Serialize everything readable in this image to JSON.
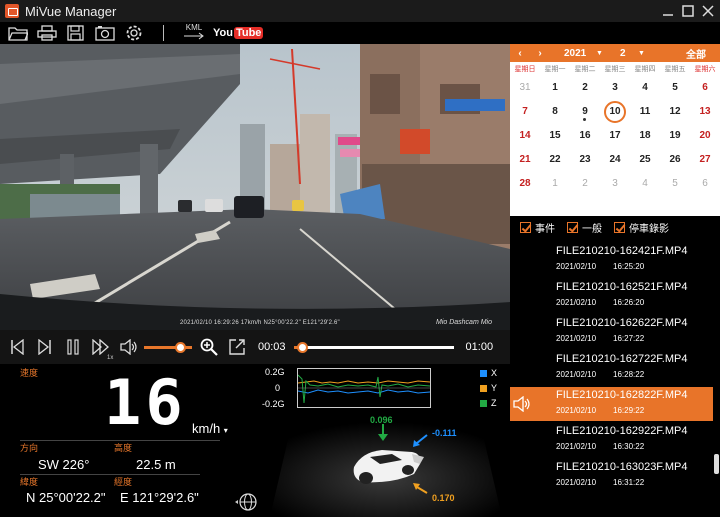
{
  "window": {
    "title": "MiVue Manager"
  },
  "toolbar": {
    "kml_label": "KML",
    "youtube_you": "You",
    "youtube_tube": "Tube"
  },
  "video": {
    "overlay_text": "2021/02/10  16:29:26  17km/h  N25°00'22.2\"  E121°29'2.6\"",
    "brand": "Mio Dashcam  Mio"
  },
  "controls": {
    "speed_label": "1x",
    "current_time": "00:03",
    "total_time": "01:00",
    "progress": 0.05,
    "volume": 0.75
  },
  "info": {
    "speed_label": "速度",
    "speed_value": "16",
    "speed_unit": "km/h",
    "heading_label": "方向",
    "heading_value": "SW 226°",
    "altitude_label": "高度",
    "altitude_value": "22.5  m",
    "latitude_label": "緯度",
    "latitude_value": "N 25°00'22.2\"",
    "longitude_label": "經度",
    "longitude_value": "E 121°29'2.6\""
  },
  "gsensor": {
    "y_labels": [
      "0.2G",
      "0",
      "-0.2G"
    ],
    "legend": [
      {
        "name": "X",
        "color": "#1e90ff"
      },
      {
        "name": "Y",
        "color": "#f0a020"
      },
      {
        "name": "Z",
        "color": "#22aa44"
      }
    ],
    "values": {
      "z": "0.096",
      "x": "-0.111",
      "y": "0.170"
    }
  },
  "calendar": {
    "year": "2021",
    "month": "2",
    "all_label": "全部",
    "weekdays": [
      "星期日",
      "星期一",
      "星期二",
      "星期三",
      "星期四",
      "星期五",
      "星期六"
    ],
    "days": [
      {
        "d": "31",
        "dim": true,
        "red": true
      },
      {
        "d": "1"
      },
      {
        "d": "2"
      },
      {
        "d": "3"
      },
      {
        "d": "4"
      },
      {
        "d": "5"
      },
      {
        "d": "6",
        "red": true
      },
      {
        "d": "7",
        "red": true
      },
      {
        "d": "8"
      },
      {
        "d": "9",
        "dot": true
      },
      {
        "d": "10",
        "today": true
      },
      {
        "d": "11"
      },
      {
        "d": "12"
      },
      {
        "d": "13",
        "red": true
      },
      {
        "d": "14",
        "red": true
      },
      {
        "d": "15"
      },
      {
        "d": "16"
      },
      {
        "d": "17"
      },
      {
        "d": "18"
      },
      {
        "d": "19"
      },
      {
        "d": "20",
        "red": true
      },
      {
        "d": "21",
        "red": true
      },
      {
        "d": "22"
      },
      {
        "d": "23"
      },
      {
        "d": "24"
      },
      {
        "d": "25"
      },
      {
        "d": "26"
      },
      {
        "d": "27",
        "red": true
      },
      {
        "d": "28",
        "red": true
      },
      {
        "d": "1",
        "dim": true
      },
      {
        "d": "2",
        "dim": true
      },
      {
        "d": "3",
        "dim": true
      },
      {
        "d": "4",
        "dim": true
      },
      {
        "d": "5",
        "dim": true
      },
      {
        "d": "6",
        "dim": true
      }
    ]
  },
  "filters": [
    {
      "label": "事件",
      "checked": true
    },
    {
      "label": "一般",
      "checked": true
    },
    {
      "label": "停車錄影",
      "checked": true
    }
  ],
  "files": [
    {
      "name": "FILE210210-162421F.MP4",
      "date": "2021/02/10",
      "time": "16:25:20",
      "selected": false
    },
    {
      "name": "FILE210210-162521F.MP4",
      "date": "2021/02/10",
      "time": "16:26:20",
      "selected": false
    },
    {
      "name": "FILE210210-162622F.MP4",
      "date": "2021/02/10",
      "time": "16:27:22",
      "selected": false
    },
    {
      "name": "FILE210210-162722F.MP4",
      "date": "2021/02/10",
      "time": "16:28:22",
      "selected": false
    },
    {
      "name": "FILE210210-162822F.MP4",
      "date": "2021/02/10",
      "time": "16:29:22",
      "selected": true
    },
    {
      "name": "FILE210210-162922F.MP4",
      "date": "2021/02/10",
      "time": "16:30:22",
      "selected": false
    },
    {
      "name": "FILE210210-163023F.MP4",
      "date": "2021/02/10",
      "time": "16:31:22",
      "selected": false
    }
  ]
}
